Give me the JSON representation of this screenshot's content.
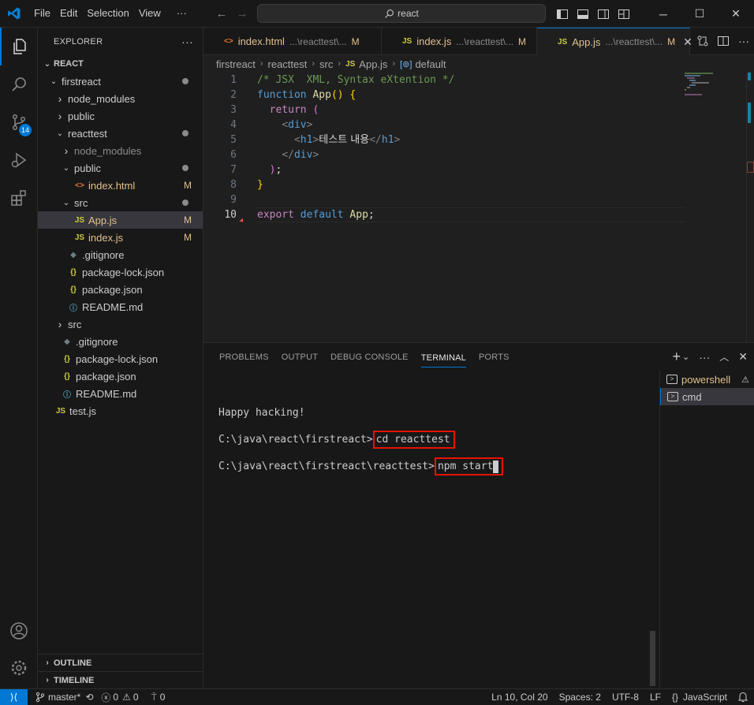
{
  "titlebar": {
    "menu": [
      "File",
      "Edit",
      "Selection",
      "View",
      "···"
    ],
    "search_text": "react",
    "window_controls": [
      "minimize",
      "maximize",
      "close"
    ]
  },
  "activitybar": {
    "items": [
      "explorer-icon",
      "search-icon",
      "source-control-icon",
      "run-debug-icon",
      "extensions-icon"
    ],
    "scm_badge": "14",
    "bottom": [
      "account-icon",
      "settings-gear-icon"
    ]
  },
  "explorer": {
    "title": "EXPLORER",
    "more": "···",
    "root": "REACT",
    "tree": [
      {
        "label": "firstreact",
        "type": "folder-open",
        "depth": 1,
        "status": "dot"
      },
      {
        "label": "node_modules",
        "type": "folder",
        "depth": 2,
        "status": ""
      },
      {
        "label": "public",
        "type": "folder",
        "depth": 2,
        "status": ""
      },
      {
        "label": "reacttest",
        "type": "folder-open",
        "depth": 2,
        "status": "dot"
      },
      {
        "label": "node_modules",
        "type": "folder",
        "depth": 3,
        "status": "",
        "muted": true
      },
      {
        "label": "public",
        "type": "folder-open",
        "depth": 3,
        "status": "dot"
      },
      {
        "label": "index.html",
        "type": "html",
        "depth": 4,
        "status": "M"
      },
      {
        "label": "src",
        "type": "folder-open",
        "depth": 3,
        "status": "dot"
      },
      {
        "label": "App.js",
        "type": "js",
        "depth": 4,
        "status": "M",
        "selected": true
      },
      {
        "label": "index.js",
        "type": "js",
        "depth": 4,
        "status": "M"
      },
      {
        "label": ".gitignore",
        "type": "git",
        "depth": 3,
        "status": ""
      },
      {
        "label": "package-lock.json",
        "type": "json",
        "depth": 3,
        "status": ""
      },
      {
        "label": "package.json",
        "type": "json",
        "depth": 3,
        "status": ""
      },
      {
        "label": "README.md",
        "type": "info",
        "depth": 3,
        "status": ""
      },
      {
        "label": "src",
        "type": "folder",
        "depth": 2,
        "status": ""
      },
      {
        "label": ".gitignore",
        "type": "git",
        "depth": 2,
        "status": ""
      },
      {
        "label": "package-lock.json",
        "type": "json",
        "depth": 2,
        "status": ""
      },
      {
        "label": "package.json",
        "type": "json",
        "depth": 2,
        "status": ""
      },
      {
        "label": "README.md",
        "type": "info",
        "depth": 2,
        "status": ""
      },
      {
        "label": "test.js",
        "type": "js",
        "depth": 1,
        "status": ""
      }
    ],
    "outline": "OUTLINE",
    "timeline": "TIMELINE"
  },
  "tabs": [
    {
      "name": "index.html",
      "path": "...\\reacttest\\...",
      "status": "M",
      "icon": "html",
      "active": false
    },
    {
      "name": "index.js",
      "path": "...\\reacttest\\...",
      "status": "M",
      "icon": "js",
      "active": false
    },
    {
      "name": "App.js",
      "path": "...\\reacttest\\...",
      "status": "M",
      "icon": "js",
      "active": true
    }
  ],
  "breadcrumbs": [
    "firstreact",
    "reacttest",
    "src",
    "App.js",
    "default"
  ],
  "editor": {
    "current_line": 10,
    "lines": [
      {
        "n": "1",
        "text": "/* JSX  XML, Syntax eXtention */"
      },
      {
        "n": "2",
        "text": "function App() {"
      },
      {
        "n": "3",
        "text": "  return ("
      },
      {
        "n": "4",
        "text": "    <div>"
      },
      {
        "n": "5",
        "text": "      <h1>테스트 내용</h1>"
      },
      {
        "n": "6",
        "text": "    </div>"
      },
      {
        "n": "7",
        "text": "  );"
      },
      {
        "n": "8",
        "text": "}"
      },
      {
        "n": "9",
        "text": ""
      },
      {
        "n": "10",
        "text": "export default App;"
      }
    ]
  },
  "panel": {
    "tabs": [
      "PROBLEMS",
      "OUTPUT",
      "DEBUG CONSOLE",
      "TERMINAL",
      "PORTS"
    ],
    "active_tab": "TERMINAL",
    "terminal_lines": [
      {
        "prompt": "Happy hacking!",
        "command": ""
      },
      {
        "prompt": "C:\\java\\react\\firstreact>",
        "command": "cd reacttest"
      },
      {
        "prompt": "C:\\java\\react\\firstreact\\reacttest>",
        "command": "npm start"
      }
    ],
    "terminals": [
      {
        "name": "powershell",
        "warn": true,
        "selected": false
      },
      {
        "name": "cmd",
        "warn": false,
        "selected": true
      }
    ]
  },
  "statusbar": {
    "branch": "master*",
    "errors": "0",
    "warnings": "0",
    "ports": "0",
    "position": "Ln 10, Col 20",
    "spaces": "Spaces: 2",
    "encoding": "UTF-8",
    "eol": "LF",
    "language": "JavaScript",
    "language_prefix": "{}"
  },
  "colors": {
    "accent": "#0078d4",
    "modified": "#e2c08d",
    "highlight_box": "#e51400",
    "js_icon": "#cbcb41",
    "html_icon": "#e37933",
    "json_icon": "#cbcb41",
    "info_icon": "#519aba"
  }
}
